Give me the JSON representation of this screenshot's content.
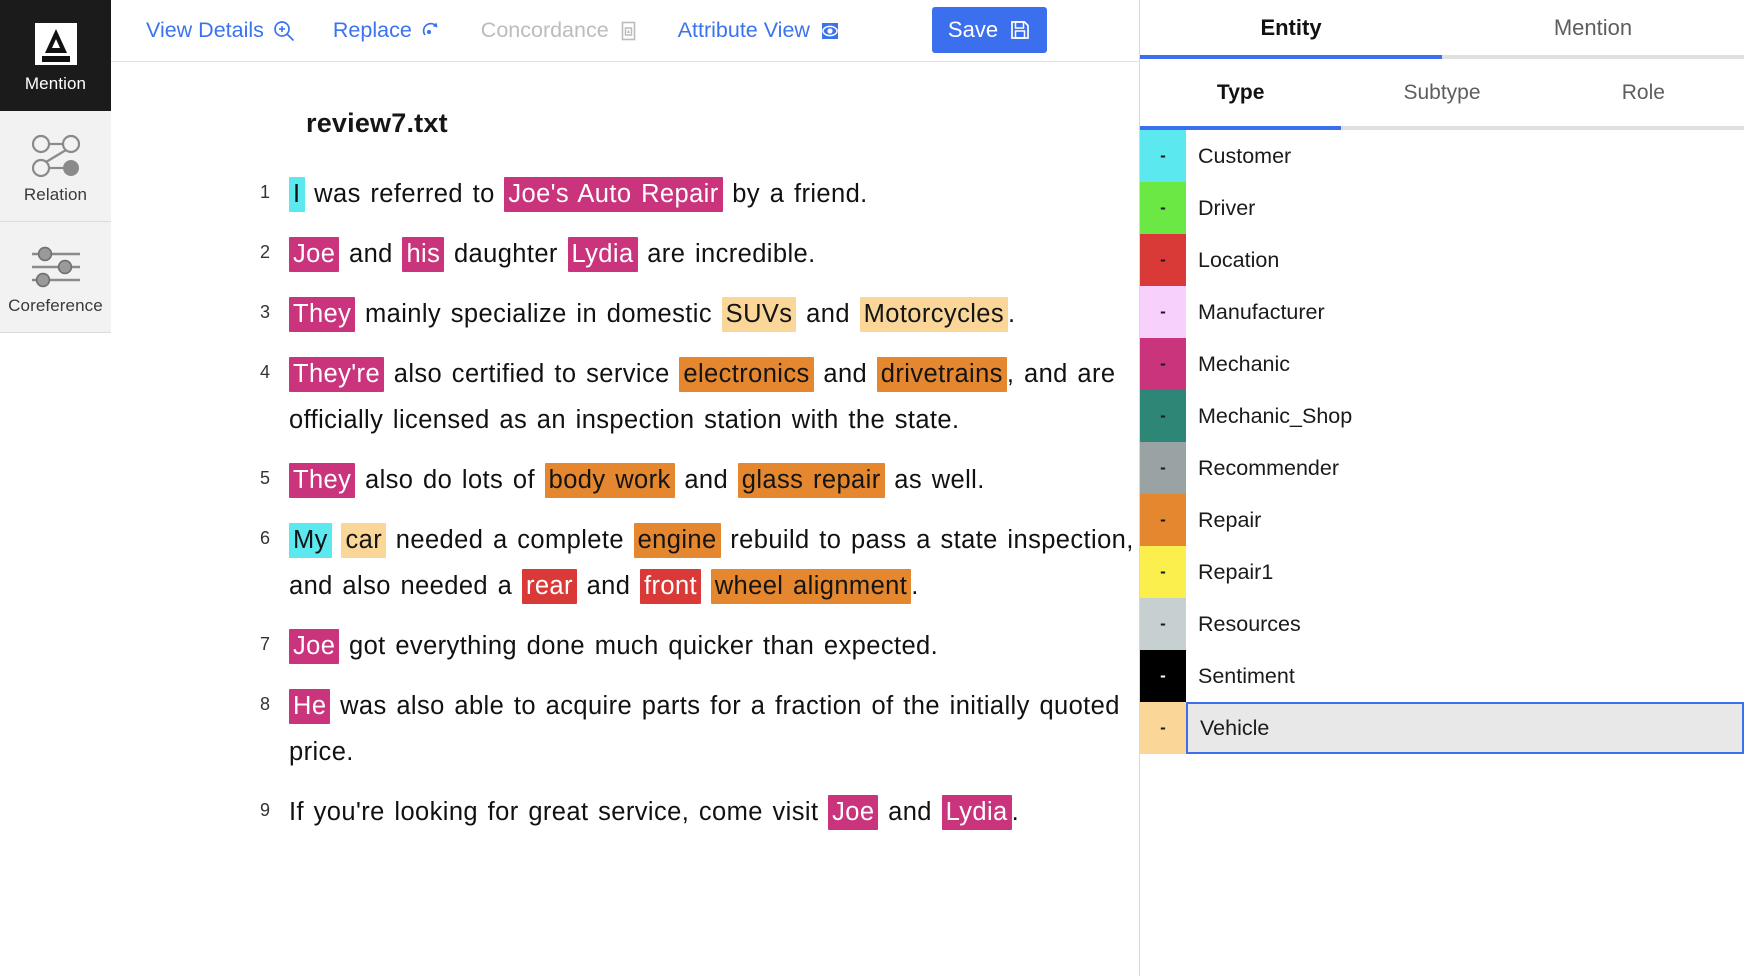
{
  "rail": {
    "items": [
      {
        "label": "Mention",
        "icon": "letter-a-annotation-icon",
        "active": true
      },
      {
        "label": "Relation",
        "icon": "relation-graph-icon",
        "active": false
      },
      {
        "label": "Coreference",
        "icon": "sliders-icon",
        "active": false
      }
    ]
  },
  "toolbar": {
    "buttons": [
      {
        "label": "View Details",
        "icon": "magnifier-plus-icon",
        "disabled": false
      },
      {
        "label": "Replace",
        "icon": "replace-arrow-icon",
        "disabled": false
      },
      {
        "label": "Concordance",
        "icon": "concordance-document-icon",
        "disabled": true
      },
      {
        "label": "Attribute View",
        "icon": "eye-icon",
        "disabled": false
      }
    ],
    "save_label": "Save",
    "save_icon": "floppy-disk-icon"
  },
  "document": {
    "title": "review7.txt",
    "lines": [
      {
        "no": "1",
        "parts": [
          {
            "t": "I",
            "c": "customer"
          },
          {
            "t": " was referred to "
          },
          {
            "t": "Joe's Auto Repair",
            "c": "mechanic_shop_pink"
          },
          {
            "t": " by a friend."
          }
        ]
      },
      {
        "no": "2",
        "parts": [
          {
            "t": "Joe",
            "c": "mechanic"
          },
          {
            "t": " and "
          },
          {
            "t": "his",
            "c": "mechanic"
          },
          {
            "t": " daughter "
          },
          {
            "t": "Lydia",
            "c": "mechanic"
          },
          {
            "t": " are incredible."
          }
        ]
      },
      {
        "no": "3",
        "parts": [
          {
            "t": "They",
            "c": "mechanic"
          },
          {
            "t": " mainly specialize in domestic "
          },
          {
            "t": "SUVs",
            "c": "vehicle"
          },
          {
            "t": " and "
          },
          {
            "t": "Motorcycles",
            "c": "vehicle"
          },
          {
            "t": "."
          }
        ]
      },
      {
        "no": "4",
        "parts": [
          {
            "t": "They're",
            "c": "mechanic"
          },
          {
            "t": " also certified to service "
          },
          {
            "t": "electronics",
            "c": "repair"
          },
          {
            "t": " and "
          },
          {
            "t": "drivetrains",
            "c": "repair"
          },
          {
            "t": ", and are officially licensed as an inspection station with the state."
          }
        ]
      },
      {
        "no": "5",
        "parts": [
          {
            "t": "They",
            "c": "mechanic"
          },
          {
            "t": " also do lots of "
          },
          {
            "t": "body work",
            "c": "repair"
          },
          {
            "t": " and "
          },
          {
            "t": "glass repair",
            "c": "repair"
          },
          {
            "t": " as well."
          }
        ]
      },
      {
        "no": "6",
        "parts": [
          {
            "t": "My",
            "c": "customer"
          },
          {
            "t": " "
          },
          {
            "t": "car",
            "c": "vehicle"
          },
          {
            "t": " needed a complete "
          },
          {
            "t": "engine",
            "c": "repair"
          },
          {
            "t": " rebuild to pass a state inspection, and also needed a "
          },
          {
            "t": "rear",
            "c": "location"
          },
          {
            "t": " and "
          },
          {
            "t": "front",
            "c": "location"
          },
          {
            "t": " "
          },
          {
            "t": "wheel alignment",
            "c": "repair"
          },
          {
            "t": "."
          }
        ]
      },
      {
        "no": "7",
        "parts": [
          {
            "t": "Joe",
            "c": "mechanic"
          },
          {
            "t": " got everything done much quicker than expected."
          }
        ]
      },
      {
        "no": "8",
        "parts": [
          {
            "t": "He",
            "c": "mechanic"
          },
          {
            "t": " was also able to acquire parts for a fraction of the initially quoted price."
          }
        ]
      },
      {
        "no": "9",
        "parts": [
          {
            "t": "If you're looking for great service, come visit "
          },
          {
            "t": "Joe",
            "c": "mechanic"
          },
          {
            "t": " and "
          },
          {
            "t": "Lydia",
            "c": "mechanic"
          },
          {
            "t": "."
          }
        ]
      }
    ]
  },
  "panel": {
    "main_tabs": [
      {
        "label": "Entity",
        "active": true
      },
      {
        "label": "Mention",
        "active": false
      }
    ],
    "sub_tabs": [
      {
        "label": "Type",
        "active": true
      },
      {
        "label": "Subtype",
        "active": false
      },
      {
        "label": "Role",
        "active": false
      }
    ],
    "swatch_label": "-",
    "types": [
      {
        "label": "Customer",
        "color": "#5ce8ef",
        "fg": "#1a1a1a",
        "selected": false
      },
      {
        "label": "Driver",
        "color": "#6ce845",
        "fg": "#1a1a1a",
        "selected": false
      },
      {
        "label": "Location",
        "color": "#da3a37",
        "fg": "#1a1a1a",
        "selected": false
      },
      {
        "label": "Manufacturer",
        "color": "#f7d0fb",
        "fg": "#1a1a1a",
        "selected": false
      },
      {
        "label": "Mechanic",
        "color": "#c9347d",
        "fg": "#1a1a1a",
        "selected": false
      },
      {
        "label": "Mechanic_Shop",
        "color": "#2e8677",
        "fg": "#1a1a1a",
        "selected": false
      },
      {
        "label": "Recommender",
        "color": "#9aa3a3",
        "fg": "#1a1a1a",
        "selected": false
      },
      {
        "label": "Repair",
        "color": "#e4872f",
        "fg": "#1a1a1a",
        "selected": false
      },
      {
        "label": "Repair1",
        "color": "#fbef4d",
        "fg": "#1a1a1a",
        "selected": false
      },
      {
        "label": "Resources",
        "color": "#c6d0d0",
        "fg": "#1a1a1a",
        "selected": false
      },
      {
        "label": "Sentiment",
        "color": "#000000",
        "fg": "#ffffff",
        "selected": false
      },
      {
        "label": "Vehicle",
        "color": "#fad699",
        "fg": "#1a1a1a",
        "selected": true
      }
    ]
  },
  "highlight_colors": {
    "customer": "#5ce8ef",
    "mechanic": "#c9347d",
    "mechanic_shop_pink": "#c9347d",
    "vehicle": "#fad699",
    "repair": "#e4872f",
    "location": "#da3a37"
  }
}
